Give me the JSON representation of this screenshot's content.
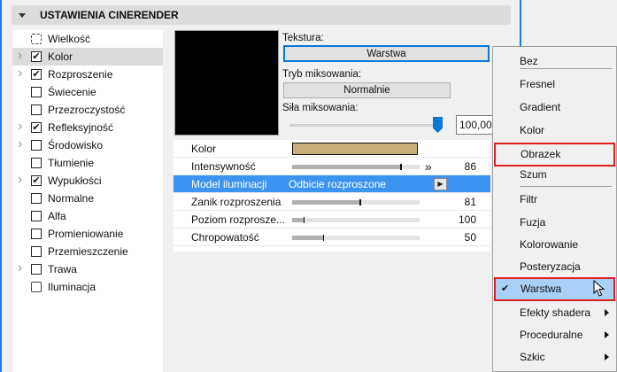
{
  "header": {
    "title": "USTAWIENIA CINERENDER"
  },
  "tree": [
    {
      "label": "Wielkość",
      "expandable": false,
      "checkbox": null,
      "icon": "size-icon"
    },
    {
      "label": "Kolor",
      "expandable": true,
      "checkbox": true,
      "selected": true
    },
    {
      "label": "Rozproszenie",
      "expandable": true,
      "checkbox": true
    },
    {
      "label": "Świecenie",
      "expandable": false,
      "checkbox": false
    },
    {
      "label": "Przezroczystość",
      "expandable": false,
      "checkbox": false
    },
    {
      "label": "Refleksyjność",
      "expandable": true,
      "checkbox": true
    },
    {
      "label": "Środowisko",
      "expandable": true,
      "checkbox": false
    },
    {
      "label": "Tłumienie",
      "expandable": false,
      "checkbox": false
    },
    {
      "label": "Wypukłości",
      "expandable": true,
      "checkbox": true
    },
    {
      "label": "Normalne",
      "expandable": false,
      "checkbox": false
    },
    {
      "label": "Alfa",
      "expandable": false,
      "checkbox": false
    },
    {
      "label": "Promieniowanie",
      "expandable": false,
      "checkbox": false
    },
    {
      "label": "Przemieszczenie",
      "expandable": false,
      "checkbox": false
    },
    {
      "label": "Trawa",
      "expandable": true,
      "checkbox": false
    },
    {
      "label": "Iluminacja",
      "expandable": false,
      "checkbox": null,
      "icon": "illumination-icon"
    }
  ],
  "texture": {
    "label": "Tekstura:",
    "value": "Warstwa"
  },
  "blend_mode": {
    "label": "Tryb miksowania:",
    "value": "Normalnie"
  },
  "blend_strength": {
    "label": "Siła miksowania:",
    "value": "100,00",
    "fraction": 1.0
  },
  "properties": [
    {
      "name": "Kolor",
      "color": "#c8ae78"
    },
    {
      "name": "Intensywność",
      "value": "86",
      "fraction": 0.86
    },
    {
      "name": "Model iluminacji",
      "value": "Odbicie rozproszone",
      "selected": true
    },
    {
      "name": "Zanik rozproszenia",
      "value": "81",
      "fraction": 0.54
    },
    {
      "name": "Poziom rozprosze...",
      "value": "100",
      "fraction": 0.1
    },
    {
      "name": "Chropowatość",
      "value": "50",
      "fraction": 0.25
    }
  ],
  "menu": [
    {
      "label": "Bez"
    },
    {
      "sep": true
    },
    {
      "label": "Fresnel"
    },
    {
      "label": "Gradient"
    },
    {
      "label": "Kolor"
    },
    {
      "label": "Obrazek",
      "highlight": true
    },
    {
      "label": "Szum"
    },
    {
      "sep": true
    },
    {
      "label": "Filtr"
    },
    {
      "label": "Fuzja"
    },
    {
      "label": "Kolorowanie"
    },
    {
      "label": "Posteryzacja"
    },
    {
      "label": "Warstwa",
      "checked": true,
      "highlight": true
    },
    {
      "label": "Efekty shadera",
      "submenu": true
    },
    {
      "label": "Proceduralne",
      "submenu": true
    },
    {
      "label": "Szkic",
      "submenu": true
    }
  ]
}
